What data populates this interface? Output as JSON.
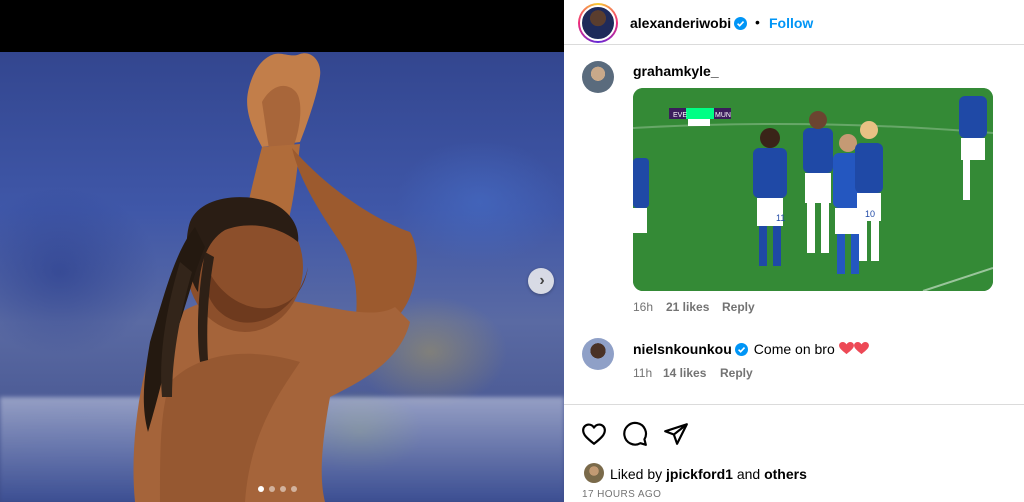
{
  "post": {
    "author": "alexanderiwobi",
    "follow_label": "Follow",
    "separator": "•",
    "carousel": {
      "slide_count": 4,
      "active_index": 0
    }
  },
  "comments": [
    {
      "username": "grahamkyle_",
      "gif": {
        "score_home": "EVE",
        "score_away": "MUN",
        "shirt_numbers": [
          "11",
          "10"
        ]
      },
      "time": "16h",
      "likes": "21 likes",
      "reply_label": "Reply"
    },
    {
      "username": "nielsnkounkou",
      "text": "Come on bro",
      "time": "11h",
      "likes": "14 likes",
      "reply_label": "Reply"
    }
  ],
  "likes": {
    "prefix": "Liked by",
    "user": "jpickford1",
    "joiner": "and",
    "others": "others"
  },
  "timestamp": "17 HOURS AGO",
  "colors": {
    "accent": "#0095f6",
    "heart": "#ed4956",
    "secondary_text": "#737373",
    "divider": "#dbdbdb"
  },
  "icons": [
    "heart-icon",
    "comment-icon",
    "share-icon",
    "verified-icon",
    "chevron-right-icon"
  ]
}
